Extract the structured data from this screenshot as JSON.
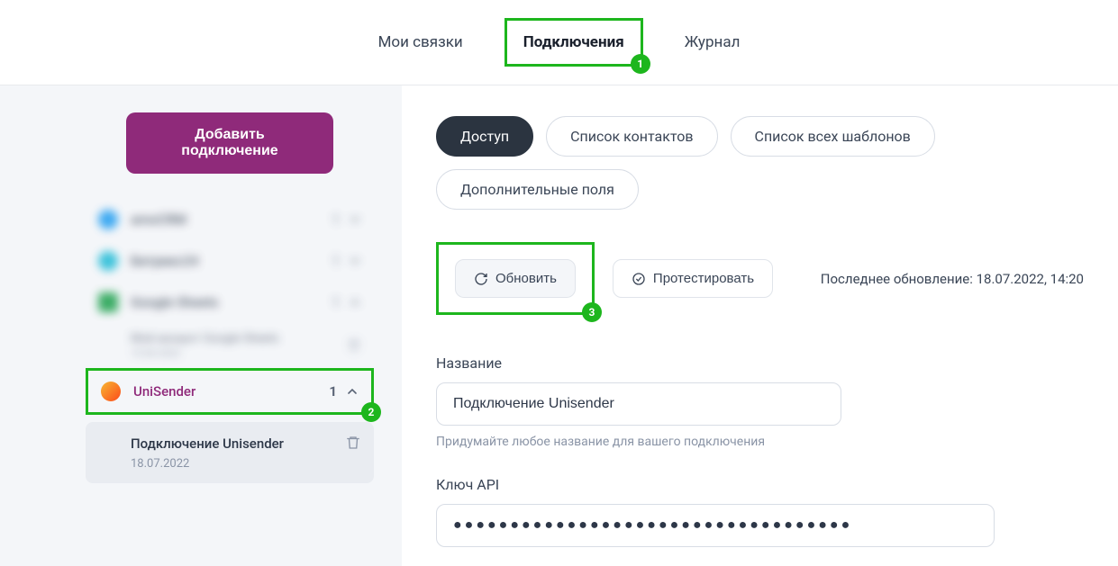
{
  "tabs": {
    "links": "Мои связки",
    "connections": "Подключения",
    "journal": "Журнал"
  },
  "badges": {
    "tab": "1",
    "sidebar": "2",
    "refresh": "3"
  },
  "sidebar": {
    "add_button": "Добавить подключение",
    "items": [
      {
        "label": "amoCRM",
        "count": "1"
      },
      {
        "label": "Битрикс24",
        "count": "1"
      },
      {
        "label": "Google Sheets",
        "count": "1"
      }
    ],
    "subaccount_blur": {
      "title": "Мой аккаунт Google Sheets",
      "date": "15.06.2022"
    },
    "unisender": {
      "label": "UniSender",
      "count": "1",
      "sub_title": "Подключение Unisender",
      "sub_date": "18.07.2022"
    }
  },
  "pills": {
    "access": "Доступ",
    "contacts": "Список контактов",
    "templates": "Список всех шаблонов",
    "extra": "Дополнительные поля"
  },
  "actions": {
    "refresh": "Обновить",
    "test": "Протестировать",
    "last_update": "Последнее обновление: 18.07.2022, 14:20"
  },
  "form": {
    "name_label": "Название",
    "name_value": "Подключение Unisender",
    "name_hint": "Придумайте любое название для вашего подключения",
    "api_label": "Ключ API",
    "api_value": "●●●●●●●●●●●●●●●●●●●●●●●●●●●●●●●●●●●"
  }
}
